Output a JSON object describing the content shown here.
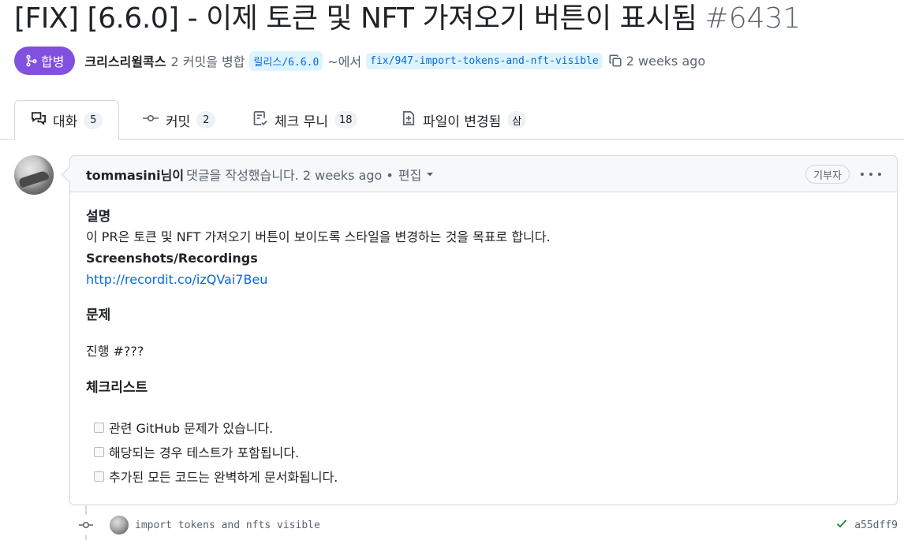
{
  "pr": {
    "title": "[FIX] [6.6.0] - 이제 토큰 및 NFT 가져오기 버튼이 표시됨",
    "number": "#6431",
    "state": "합병",
    "author": "크리스리윌콕스",
    "merge_text": "2 커밋을 병합",
    "base_branch": "릴리스/6.6.0",
    "from_text": "~에서",
    "head_branch": "fix/947-import-tokens-and-nft-visible",
    "time": "2 weeks ago"
  },
  "tabs": [
    {
      "label": "대화",
      "count": "5",
      "icon": "comment-discussion-icon"
    },
    {
      "label": "커밋",
      "count": "2",
      "icon": "git-commit-icon"
    },
    {
      "label": "체크 무니",
      "count": "18",
      "icon": "checklist-icon"
    },
    {
      "label": "파일이 변경됨",
      "count": "삼",
      "icon": "file-diff-icon"
    }
  ],
  "comment": {
    "author": "tommasini님이",
    "action": "댓글을 작성했습니다. 2 weeks ago •",
    "edit_label": "편집",
    "role_badge": "기부자",
    "heading_description": "설명",
    "description": "이 PR은 토큰 및 NFT 가져오기 버튼이 보이도록 스타일을 변경하는 것을 목표로 합니다.",
    "screenshots_label": "Screenshots/Recordings",
    "link": "http://recordit.co/izQVai7Beu",
    "heading_issue": "문제",
    "issue_text": "진행 #???",
    "heading_checklist": "체크리스트",
    "checklist": [
      "관련 GitHub 문제가 있습니다.",
      "해당되는 경우 테스트가 포함됩니다.",
      "추가된 모든 코드는 완벽하게 문서화됩니다."
    ]
  },
  "commit": {
    "message": "import tokens and nfts visible",
    "sha": "a55dff9"
  },
  "colors": {
    "merged": "#8250df",
    "link": "#0969da",
    "success": "#1a7f37"
  }
}
